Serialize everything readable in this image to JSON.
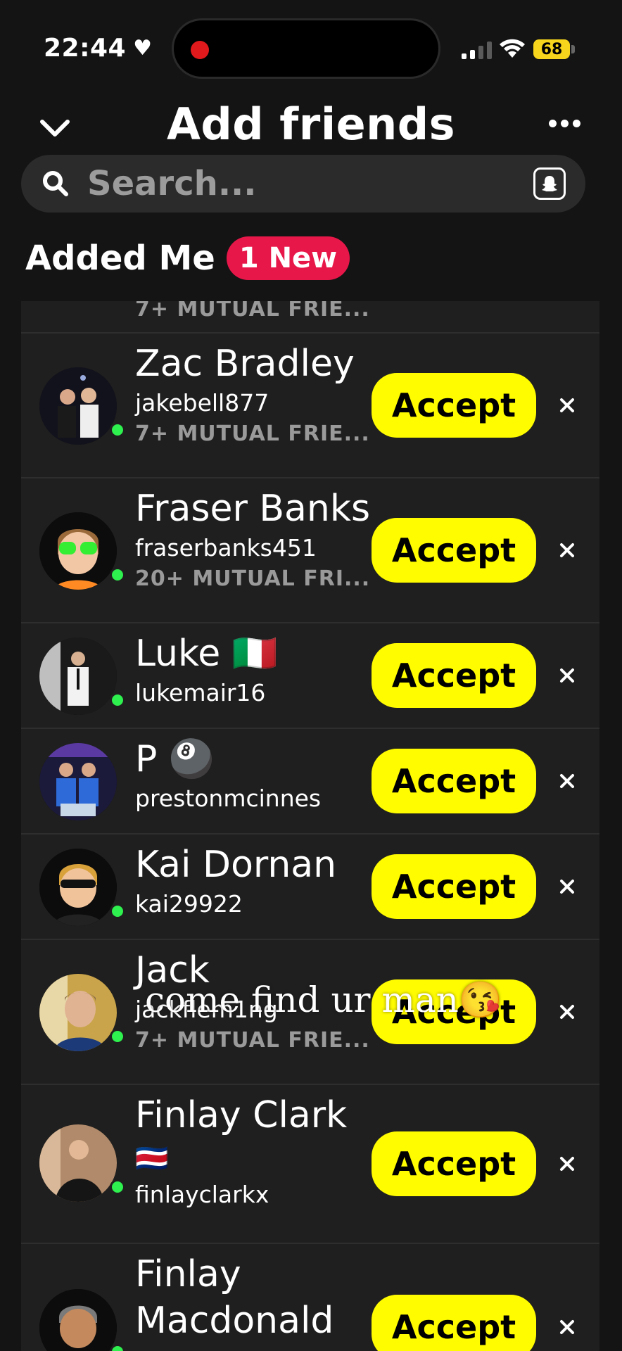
{
  "status_bar": {
    "time": "22:44",
    "heart": "♥",
    "battery": "68",
    "icons": [
      "heart-icon",
      "recording-dot-icon",
      "cellular-signal-icon",
      "wifi-icon",
      "battery-icon"
    ]
  },
  "header": {
    "title": "Add friends",
    "back_icon": "chevron-down-icon",
    "more_icon": "more-horizontal-icon"
  },
  "search": {
    "placeholder": "Search...",
    "icon": "search-icon",
    "right_icon": "snapcode-icon"
  },
  "section": {
    "title": "Added Me",
    "badge": "1 New"
  },
  "list": {
    "partial_mutual": "7+ MUTUAL FRIE...",
    "accept_label": "Accept",
    "dismiss_icon": "close-icon",
    "rows": [
      {
        "name": "Zac Bradley",
        "username": "jakebell877",
        "mutual": "7+ MUTUAL FRIE..."
      },
      {
        "name": "Fraser Banks",
        "username": "fraserbanks451",
        "mutual": "20+ MUTUAL FRI..."
      },
      {
        "name": "Luke 🇮🇹",
        "username": "lukemair16",
        "mutual": ""
      },
      {
        "name": "P 🎱",
        "username": "prestonmcinnes",
        "mutual": ""
      },
      {
        "name": "Kai Dornan",
        "username": "kai29922",
        "mutual": ""
      },
      {
        "name": "Jack",
        "username": "jackflem1ng",
        "mutual": "7+ MUTUAL FRIE..."
      },
      {
        "name": "Finlay Clark",
        "flag": "🇨🇷",
        "username": "finlayclarkx",
        "mutual": ""
      },
      {
        "name_line1": "Finlay",
        "name_line2": "Macdonald",
        "username": "",
        "mutual": ""
      }
    ]
  },
  "overlay": {
    "caption": "come find ur man😘"
  },
  "colors": {
    "accept_bg": "#fffc00",
    "badge_bg": "#e8174a",
    "online": "#2ef04e",
    "background": "#141414",
    "list_bg": "#1f1f1f"
  }
}
